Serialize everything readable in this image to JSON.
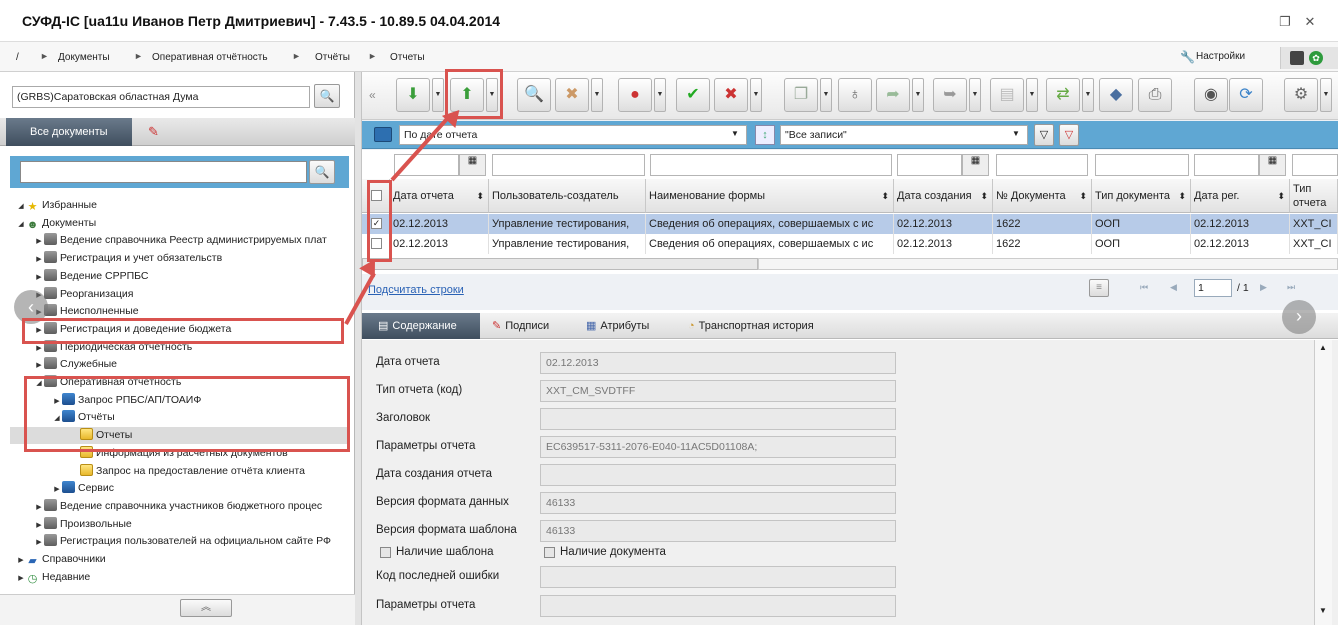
{
  "window": {
    "title": "СУФД-IC [ua11u Иванов Петр Дмитриевич] - 7.43.5 - 10.89.5 04.04.2014"
  },
  "breadcrumb": {
    "root": "/",
    "items": [
      "Документы",
      "Оперативная отчётность",
      "Отчёты",
      "Отчеты"
    ]
  },
  "header": {
    "settings_label": "Настройки"
  },
  "left": {
    "org_value": "(GRBS)Саратовская областная Дума",
    "tab_all_docs": "Все документы",
    "search_value": "",
    "tree": [
      {
        "label": "Избранные",
        "level": 0,
        "icon": "star-icon",
        "expanded": true
      },
      {
        "label": "Документы",
        "level": 0,
        "icon": "users-icon",
        "expanded": true
      },
      {
        "label": "Ведение справочника Реестр администрируемых плат",
        "level": 1,
        "icon": "folder-grey-icon"
      },
      {
        "label": "Регистрация и учет обязательств",
        "level": 1,
        "icon": "folder-grey-icon"
      },
      {
        "label": "Ведение СРРПБС",
        "level": 1,
        "icon": "folder-grey-icon"
      },
      {
        "label": "Реорганизация",
        "level": 1,
        "icon": "folder-grey-icon"
      },
      {
        "label": "Неисполненные",
        "level": 1,
        "icon": "folder-grey-icon"
      },
      {
        "label": "Регистрация и доведение бюджета",
        "level": 1,
        "icon": "folder-grey-icon"
      },
      {
        "label": "Периодическая отчётность",
        "level": 1,
        "icon": "folder-grey-icon"
      },
      {
        "label": "Служебные",
        "level": 1,
        "icon": "folder-grey-icon"
      },
      {
        "label": "Оперативная отчётность",
        "level": 1,
        "icon": "folder-grey-icon",
        "expanded": true
      },
      {
        "label": "Запрос РПБС/АП/ТОАИФ",
        "level": 2,
        "icon": "folder-blue-icon"
      },
      {
        "label": "Отчёты",
        "level": 2,
        "icon": "folder-blue-icon",
        "expanded": true
      },
      {
        "label": "Отчеты",
        "level": 3,
        "icon": "folder-yellow-icon",
        "selected": true
      },
      {
        "label": "Информация из расчетных документов",
        "level": 3,
        "icon": "folder-yellow-icon"
      },
      {
        "label": "Запрос на предоставление отчёта клиента",
        "level": 3,
        "icon": "folder-yellow-icon"
      },
      {
        "label": "Сервис",
        "level": 2,
        "icon": "folder-blue-icon"
      },
      {
        "label": "Ведение справочника участников бюджетного процес",
        "level": 1,
        "icon": "folder-grey-icon"
      },
      {
        "label": "Произвольные",
        "level": 1,
        "icon": "folder-grey-icon"
      },
      {
        "label": "Регистрация пользователей на официальном сайте РФ",
        "level": 1,
        "icon": "folder-grey-icon"
      },
      {
        "label": "Справочники",
        "level": 0,
        "icon": "book-icon"
      },
      {
        "label": "Недавние",
        "level": 0,
        "icon": "clock-icon"
      }
    ]
  },
  "filter": {
    "field_value": "По дате отчета",
    "records_value": "\"Все записи\""
  },
  "grid": {
    "columns": [
      "Дата отчета",
      "Пользователь-создатель",
      "Наименование формы",
      "Дата создания",
      "№ Документа",
      "Тип документа",
      "Дата рег.",
      "Тип отчета (код)"
    ],
    "rows": [
      {
        "checked": true,
        "cells": [
          "02.12.2013",
          "Управление тестирования,",
          "Сведения об операциях, совершаемых с ис",
          "02.12.2013",
          "1622",
          "ООП",
          "02.12.2013",
          "XXT_CI"
        ]
      },
      {
        "checked": false,
        "cells": [
          "02.12.2013",
          "Управление тестирования,",
          "Сведения об операциях, совершаемых с ис",
          "02.12.2013",
          "1622",
          "ООП",
          "02.12.2013",
          "XXT_CI"
        ]
      }
    ],
    "count_link": "Подсчитать строки",
    "page_current": "1",
    "page_total": "/ 1"
  },
  "detail": {
    "tabs": [
      "Содержание",
      "Подписи",
      "Атрибуты",
      "Транспортная история"
    ],
    "fields": [
      {
        "label": "Дата отчета",
        "value": "02.12.2013"
      },
      {
        "label": "Тип отчета (код)",
        "value": "XXT_CM_SVDTFF"
      },
      {
        "label": "Заголовок",
        "value": ""
      },
      {
        "label": "Параметры отчета",
        "value": "EC639517-5311-2076-E040-11AC5D01108A;"
      },
      {
        "label": "Дата создания отчета",
        "value": ""
      },
      {
        "label": "Версия формата данных",
        "value": "46133"
      },
      {
        "label": "Версия формата шаблона",
        "value": "46133"
      }
    ],
    "check_template": "Наличие шаблона",
    "check_document": "Наличие документа",
    "fields2": [
      {
        "label": "Код последней ошибки",
        "value": ""
      },
      {
        "label": "Параметры отчета",
        "value": ""
      }
    ]
  },
  "colors": {
    "accent_blue": "#5fa7d3",
    "annotation_red": "#d9534f",
    "selected_row": "#b7cbe8"
  }
}
